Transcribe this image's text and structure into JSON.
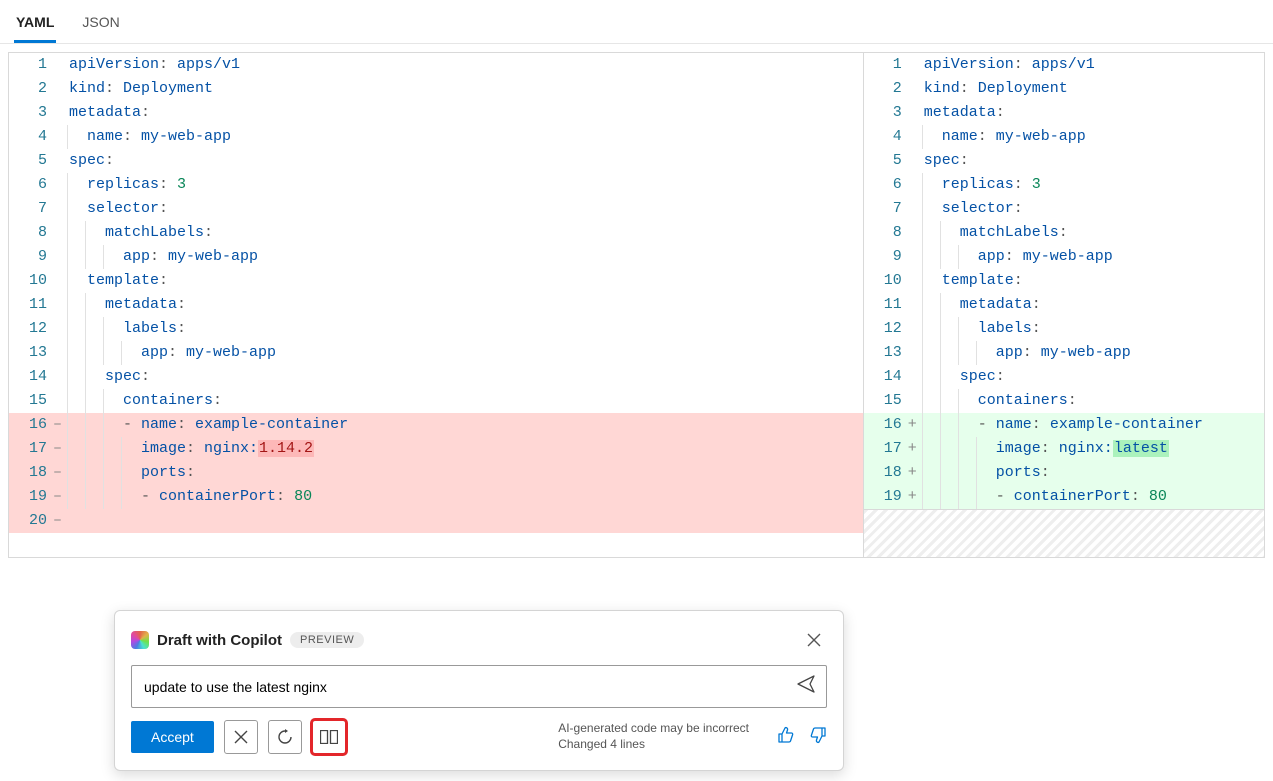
{
  "tabs": {
    "yaml": "YAML",
    "json": "JSON",
    "active": "yaml"
  },
  "left": [
    {
      "n": "1",
      "m": "",
      "indent": 0,
      "diff": "",
      "tokens": [
        [
          "key",
          "apiVersion"
        ],
        [
          "punc",
          ": "
        ],
        [
          "val",
          "apps/v1"
        ]
      ]
    },
    {
      "n": "2",
      "m": "",
      "indent": 0,
      "diff": "",
      "tokens": [
        [
          "key",
          "kind"
        ],
        [
          "punc",
          ": "
        ],
        [
          "val",
          "Deployment"
        ]
      ]
    },
    {
      "n": "3",
      "m": "",
      "indent": 0,
      "diff": "",
      "tokens": [
        [
          "key",
          "metadata"
        ],
        [
          "punc",
          ":"
        ]
      ]
    },
    {
      "n": "4",
      "m": "",
      "indent": 1,
      "diff": "",
      "tokens": [
        [
          "key",
          "name"
        ],
        [
          "punc",
          ": "
        ],
        [
          "val",
          "my-web-app"
        ]
      ]
    },
    {
      "n": "5",
      "m": "",
      "indent": 0,
      "diff": "",
      "tokens": [
        [
          "key",
          "spec"
        ],
        [
          "punc",
          ":"
        ]
      ]
    },
    {
      "n": "6",
      "m": "",
      "indent": 1,
      "diff": "",
      "tokens": [
        [
          "key",
          "replicas"
        ],
        [
          "punc",
          ": "
        ],
        [
          "num",
          "3"
        ]
      ]
    },
    {
      "n": "7",
      "m": "",
      "indent": 1,
      "diff": "",
      "tokens": [
        [
          "key",
          "selector"
        ],
        [
          "punc",
          ":"
        ]
      ]
    },
    {
      "n": "8",
      "m": "",
      "indent": 2,
      "diff": "",
      "tokens": [
        [
          "key",
          "matchLabels"
        ],
        [
          "punc",
          ":"
        ]
      ]
    },
    {
      "n": "9",
      "m": "",
      "indent": 3,
      "diff": "",
      "tokens": [
        [
          "key",
          "app"
        ],
        [
          "punc",
          ": "
        ],
        [
          "val",
          "my-web-app"
        ]
      ]
    },
    {
      "n": "10",
      "m": "",
      "indent": 1,
      "diff": "",
      "tokens": [
        [
          "key",
          "template"
        ],
        [
          "punc",
          ":"
        ]
      ]
    },
    {
      "n": "11",
      "m": "",
      "indent": 2,
      "diff": "",
      "tokens": [
        [
          "key",
          "metadata"
        ],
        [
          "punc",
          ":"
        ]
      ]
    },
    {
      "n": "12",
      "m": "",
      "indent": 3,
      "diff": "",
      "tokens": [
        [
          "key",
          "labels"
        ],
        [
          "punc",
          ":"
        ]
      ]
    },
    {
      "n": "13",
      "m": "",
      "indent": 4,
      "diff": "",
      "tokens": [
        [
          "key",
          "app"
        ],
        [
          "punc",
          ": "
        ],
        [
          "val",
          "my-web-app"
        ]
      ]
    },
    {
      "n": "14",
      "m": "",
      "indent": 2,
      "diff": "",
      "tokens": [
        [
          "key",
          "spec"
        ],
        [
          "punc",
          ":"
        ]
      ]
    },
    {
      "n": "15",
      "m": "",
      "indent": 3,
      "diff": "",
      "tokens": [
        [
          "key",
          "containers"
        ],
        [
          "punc",
          ":"
        ]
      ]
    },
    {
      "n": "16",
      "m": "–",
      "indent": 3,
      "diff": "removed",
      "tokens": [
        [
          "punc",
          "- "
        ],
        [
          "key",
          "name"
        ],
        [
          "punc",
          ": "
        ],
        [
          "val",
          "example-container"
        ]
      ]
    },
    {
      "n": "17",
      "m": "–",
      "indent": 4,
      "diff": "removed",
      "tokens": [
        [
          "key",
          "image"
        ],
        [
          "punc",
          ": "
        ],
        [
          "val",
          "nginx:"
        ],
        [
          "hl-del",
          "1.14.2"
        ]
      ]
    },
    {
      "n": "18",
      "m": "–",
      "indent": 4,
      "diff": "removed",
      "tokens": [
        [
          "key",
          "ports"
        ],
        [
          "punc",
          ":"
        ]
      ]
    },
    {
      "n": "19",
      "m": "–",
      "indent": 4,
      "diff": "removed",
      "tokens": [
        [
          "punc",
          "- "
        ],
        [
          "key",
          "containerPort"
        ],
        [
          "punc",
          ": "
        ],
        [
          "num",
          "80"
        ]
      ]
    },
    {
      "n": "20",
      "m": "–",
      "indent": 0,
      "diff": "removed-pad",
      "tokens": []
    }
  ],
  "right": [
    {
      "n": "1",
      "m": "",
      "indent": 0,
      "diff": "",
      "tokens": [
        [
          "key",
          "apiVersion"
        ],
        [
          "punc",
          ": "
        ],
        [
          "val",
          "apps/v1"
        ]
      ]
    },
    {
      "n": "2",
      "m": "",
      "indent": 0,
      "diff": "",
      "tokens": [
        [
          "key",
          "kind"
        ],
        [
          "punc",
          ": "
        ],
        [
          "val",
          "Deployment"
        ]
      ]
    },
    {
      "n": "3",
      "m": "",
      "indent": 0,
      "diff": "",
      "tokens": [
        [
          "key",
          "metadata"
        ],
        [
          "punc",
          ":"
        ]
      ]
    },
    {
      "n": "4",
      "m": "",
      "indent": 1,
      "diff": "",
      "tokens": [
        [
          "key",
          "name"
        ],
        [
          "punc",
          ": "
        ],
        [
          "val",
          "my-web-app"
        ]
      ]
    },
    {
      "n": "5",
      "m": "",
      "indent": 0,
      "diff": "",
      "tokens": [
        [
          "key",
          "spec"
        ],
        [
          "punc",
          ":"
        ]
      ]
    },
    {
      "n": "6",
      "m": "",
      "indent": 1,
      "diff": "",
      "tokens": [
        [
          "key",
          "replicas"
        ],
        [
          "punc",
          ": "
        ],
        [
          "num",
          "3"
        ]
      ]
    },
    {
      "n": "7",
      "m": "",
      "indent": 1,
      "diff": "",
      "tokens": [
        [
          "key",
          "selector"
        ],
        [
          "punc",
          ":"
        ]
      ]
    },
    {
      "n": "8",
      "m": "",
      "indent": 2,
      "diff": "",
      "tokens": [
        [
          "key",
          "matchLabels"
        ],
        [
          "punc",
          ":"
        ]
      ]
    },
    {
      "n": "9",
      "m": "",
      "indent": 3,
      "diff": "",
      "tokens": [
        [
          "key",
          "app"
        ],
        [
          "punc",
          ": "
        ],
        [
          "val",
          "my-web-app"
        ]
      ]
    },
    {
      "n": "10",
      "m": "",
      "indent": 1,
      "diff": "",
      "tokens": [
        [
          "key",
          "template"
        ],
        [
          "punc",
          ":"
        ]
      ]
    },
    {
      "n": "11",
      "m": "",
      "indent": 2,
      "diff": "",
      "tokens": [
        [
          "key",
          "metadata"
        ],
        [
          "punc",
          ":"
        ]
      ]
    },
    {
      "n": "12",
      "m": "",
      "indent": 3,
      "diff": "",
      "tokens": [
        [
          "key",
          "labels"
        ],
        [
          "punc",
          ":"
        ]
      ]
    },
    {
      "n": "13",
      "m": "",
      "indent": 4,
      "diff": "",
      "tokens": [
        [
          "key",
          "app"
        ],
        [
          "punc",
          ": "
        ],
        [
          "val",
          "my-web-app"
        ]
      ]
    },
    {
      "n": "14",
      "m": "",
      "indent": 2,
      "diff": "",
      "tokens": [
        [
          "key",
          "spec"
        ],
        [
          "punc",
          ":"
        ]
      ]
    },
    {
      "n": "15",
      "m": "",
      "indent": 3,
      "diff": "",
      "tokens": [
        [
          "key",
          "containers"
        ],
        [
          "punc",
          ":"
        ]
      ]
    },
    {
      "n": "16",
      "m": "+",
      "indent": 3,
      "diff": "added",
      "tokens": [
        [
          "punc",
          "- "
        ],
        [
          "key",
          "name"
        ],
        [
          "punc",
          ": "
        ],
        [
          "val",
          "example-container"
        ]
      ]
    },
    {
      "n": "17",
      "m": "+",
      "indent": 4,
      "diff": "added",
      "tokens": [
        [
          "key",
          "image"
        ],
        [
          "punc",
          ": "
        ],
        [
          "val",
          "nginx:"
        ],
        [
          "hl-add",
          "latest"
        ]
      ]
    },
    {
      "n": "18",
      "m": "+",
      "indent": 4,
      "diff": "added",
      "tokens": [
        [
          "key",
          "ports"
        ],
        [
          "punc",
          ":"
        ]
      ]
    },
    {
      "n": "19",
      "m": "+",
      "indent": 4,
      "diff": "added",
      "tokens": [
        [
          "punc",
          "- "
        ],
        [
          "key",
          "containerPort"
        ],
        [
          "punc",
          ": "
        ],
        [
          "num",
          "80"
        ]
      ]
    }
  ],
  "copilot": {
    "title": "Draft with Copilot",
    "badge": "PREVIEW",
    "prompt": "update to use the latest nginx",
    "accept": "Accept",
    "status1": "AI-generated code may be incorrect",
    "status2": "Changed 4 lines"
  }
}
